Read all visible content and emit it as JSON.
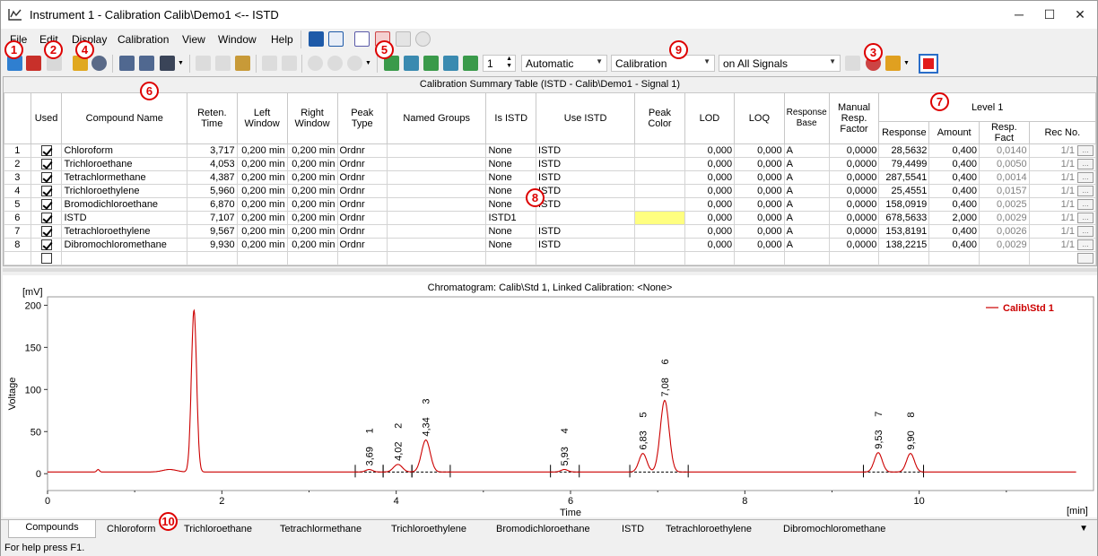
{
  "window": {
    "title": "Instrument 1 - Calibration Calib\\Demo1 <-- ISTD",
    "minimize": "─",
    "maximize": "☐",
    "close": "✕"
  },
  "menu": [
    "File",
    "Edit",
    "Display",
    "Calibration",
    "View",
    "Window",
    "Help"
  ],
  "toolbar": {
    "spin_value": "1",
    "mode_combo": "Automatic",
    "type_combo": "Calibration",
    "signal_combo": "on All Signals"
  },
  "badges": [
    "1",
    "2",
    "4",
    "5",
    "9",
    "3",
    "6",
    "7",
    "8",
    "10"
  ],
  "table": {
    "title": "Calibration Summary Table (ISTD - Calib\\Demo1 - Signal 1)",
    "headers": {
      "num": "",
      "used": "Used",
      "compound": "Compound Name",
      "reten": "Reten. Time",
      "left": "Left Window",
      "right": "Right Window",
      "peak_type": "Peak Type",
      "named_groups": "Named Groups",
      "is_istd": "Is ISTD",
      "use_istd": "Use ISTD",
      "peak_color": "Peak Color",
      "lod": "LOD",
      "loq": "LOQ",
      "resp_base": "Response Base",
      "manual": "Manual Resp. Factor",
      "level": "Level 1",
      "response": "Response",
      "amount": "Amount",
      "resp_fact": "Resp. Fact",
      "rec_no": "Rec No."
    },
    "rows": [
      {
        "n": "1",
        "used": true,
        "name": "Chloroform",
        "rt": "3,717",
        "lw": "0,200 min",
        "rw": "0,200 min",
        "pt": "Ordnr",
        "ng": "",
        "is": "None",
        "use": "ISTD",
        "color": "",
        "lod": "0,000",
        "loq": "0,000",
        "rb": "A",
        "mrf": "0,0000",
        "resp": "28,5632",
        "amt": "0,400",
        "rf": "0,0140",
        "rec": "1/1"
      },
      {
        "n": "2",
        "used": true,
        "name": "Trichloroethane",
        "rt": "4,053",
        "lw": "0,200 min",
        "rw": "0,200 min",
        "pt": "Ordnr",
        "ng": "",
        "is": "None",
        "use": "ISTD",
        "color": "",
        "lod": "0,000",
        "loq": "0,000",
        "rb": "A",
        "mrf": "0,0000",
        "resp": "79,4499",
        "amt": "0,400",
        "rf": "0,0050",
        "rec": "1/1"
      },
      {
        "n": "3",
        "used": true,
        "name": "Tetrachlormethane",
        "rt": "4,387",
        "lw": "0,200 min",
        "rw": "0,200 min",
        "pt": "Ordnr",
        "ng": "",
        "is": "None",
        "use": "ISTD",
        "color": "",
        "lod": "0,000",
        "loq": "0,000",
        "rb": "A",
        "mrf": "0,0000",
        "resp": "287,5541",
        "amt": "0,400",
        "rf": "0,0014",
        "rec": "1/1"
      },
      {
        "n": "4",
        "used": true,
        "name": "Trichloroethylene",
        "rt": "5,960",
        "lw": "0,200 min",
        "rw": "0,200 min",
        "pt": "Ordnr",
        "ng": "",
        "is": "None",
        "use": "ISTD",
        "color": "",
        "lod": "0,000",
        "loq": "0,000",
        "rb": "A",
        "mrf": "0,0000",
        "resp": "25,4551",
        "amt": "0,400",
        "rf": "0,0157",
        "rec": "1/1"
      },
      {
        "n": "5",
        "used": true,
        "name": "Bromodichloroethane",
        "rt": "6,870",
        "lw": "0,200 min",
        "rw": "0,200 min",
        "pt": "Ordnr",
        "ng": "",
        "is": "None",
        "use": "ISTD",
        "color": "",
        "lod": "0,000",
        "loq": "0,000",
        "rb": "A",
        "mrf": "0,0000",
        "resp": "158,0919",
        "amt": "0,400",
        "rf": "0,0025",
        "rec": "1/1"
      },
      {
        "n": "6",
        "used": true,
        "name": "ISTD",
        "rt": "7,107",
        "lw": "0,200 min",
        "rw": "0,200 min",
        "pt": "Ordnr",
        "ng": "",
        "is": "ISTD1",
        "use": "",
        "color": "#ffff80",
        "lod": "0,000",
        "loq": "0,000",
        "rb": "A",
        "mrf": "0,0000",
        "resp": "678,5633",
        "amt": "2,000",
        "rf": "0,0029",
        "rec": "1/1"
      },
      {
        "n": "7",
        "used": true,
        "name": "Tetrachloroethylene",
        "rt": "9,567",
        "lw": "0,200 min",
        "rw": "0,200 min",
        "pt": "Ordnr",
        "ng": "",
        "is": "None",
        "use": "ISTD",
        "color": "",
        "lod": "0,000",
        "loq": "0,000",
        "rb": "A",
        "mrf": "0,0000",
        "resp": "153,8191",
        "amt": "0,400",
        "rf": "0,0026",
        "rec": "1/1"
      },
      {
        "n": "8",
        "used": true,
        "name": "Dibromochloromethane",
        "rt": "9,930",
        "lw": "0,200 min",
        "rw": "0,200 min",
        "pt": "Ordnr",
        "ng": "",
        "is": "None",
        "use": "ISTD",
        "color": "",
        "lod": "0,000",
        "loq": "0,000",
        "rb": "A",
        "mrf": "0,0000",
        "resp": "138,2215",
        "amt": "0,400",
        "rf": "0,0029",
        "rec": "1/1"
      }
    ],
    "dots_label": "..."
  },
  "chart_data": {
    "type": "line",
    "title": "Chromatogram: Calib\\Std 1, Linked Calibration: <None>",
    "xlabel": "Time",
    "ylabel": "Voltage",
    "yunit": "[mV]",
    "xunit": "[min]",
    "xlim": [
      0,
      12
    ],
    "ylim": [
      -20,
      210
    ],
    "xticks": [
      "0",
      "2",
      "4",
      "6",
      "8",
      "10"
    ],
    "yticks": [
      "0",
      "50",
      "100",
      "150",
      "200"
    ],
    "legend": "top-right",
    "series": [
      {
        "name": "Calib\\Std 1",
        "color": "#cc0000"
      }
    ],
    "baseline": 2,
    "peaks": [
      {
        "x": 0.58,
        "h": 3,
        "w": 0.015,
        "label": ""
      },
      {
        "x": 1.4,
        "h": 3,
        "w": 0.08,
        "label": ""
      },
      {
        "x": 1.68,
        "h": 192,
        "w": 0.03,
        "label": ""
      },
      {
        "x": 3.69,
        "h": 3,
        "w": 0.04,
        "label": "3,69",
        "num": "1"
      },
      {
        "x": 4.02,
        "h": 9,
        "w": 0.05,
        "label": "4,02",
        "num": "2"
      },
      {
        "x": 4.34,
        "h": 38,
        "w": 0.05,
        "label": "4,34",
        "num": "3"
      },
      {
        "x": 5.93,
        "h": 3,
        "w": 0.04,
        "label": "5,93",
        "num": "4"
      },
      {
        "x": 6.83,
        "h": 22,
        "w": 0.045,
        "label": "6,83",
        "num": "5"
      },
      {
        "x": 7.08,
        "h": 85,
        "w": 0.05,
        "label": "7,08",
        "num": "6"
      },
      {
        "x": 9.53,
        "h": 23,
        "w": 0.045,
        "label": "9,53",
        "num": "7"
      },
      {
        "x": 9.9,
        "h": 22,
        "w": 0.045,
        "label": "9,90",
        "num": "8"
      }
    ],
    "peak_windows": [
      [
        3.53,
        3.85
      ],
      [
        3.85,
        4.18
      ],
      [
        4.18,
        4.62
      ],
      [
        5.77,
        6.1
      ],
      [
        6.68,
        7.35
      ],
      [
        9.36,
        10.05
      ]
    ]
  },
  "tabs": [
    "Compounds",
    "Chloroform",
    "Trichloroethane",
    "Tetrachlormethane",
    "Trichloroethylene",
    "Bromodichloroethane",
    "ISTD",
    "Tetrachloroethylene",
    "Dibromochloromethane"
  ],
  "status": "For help press F1."
}
